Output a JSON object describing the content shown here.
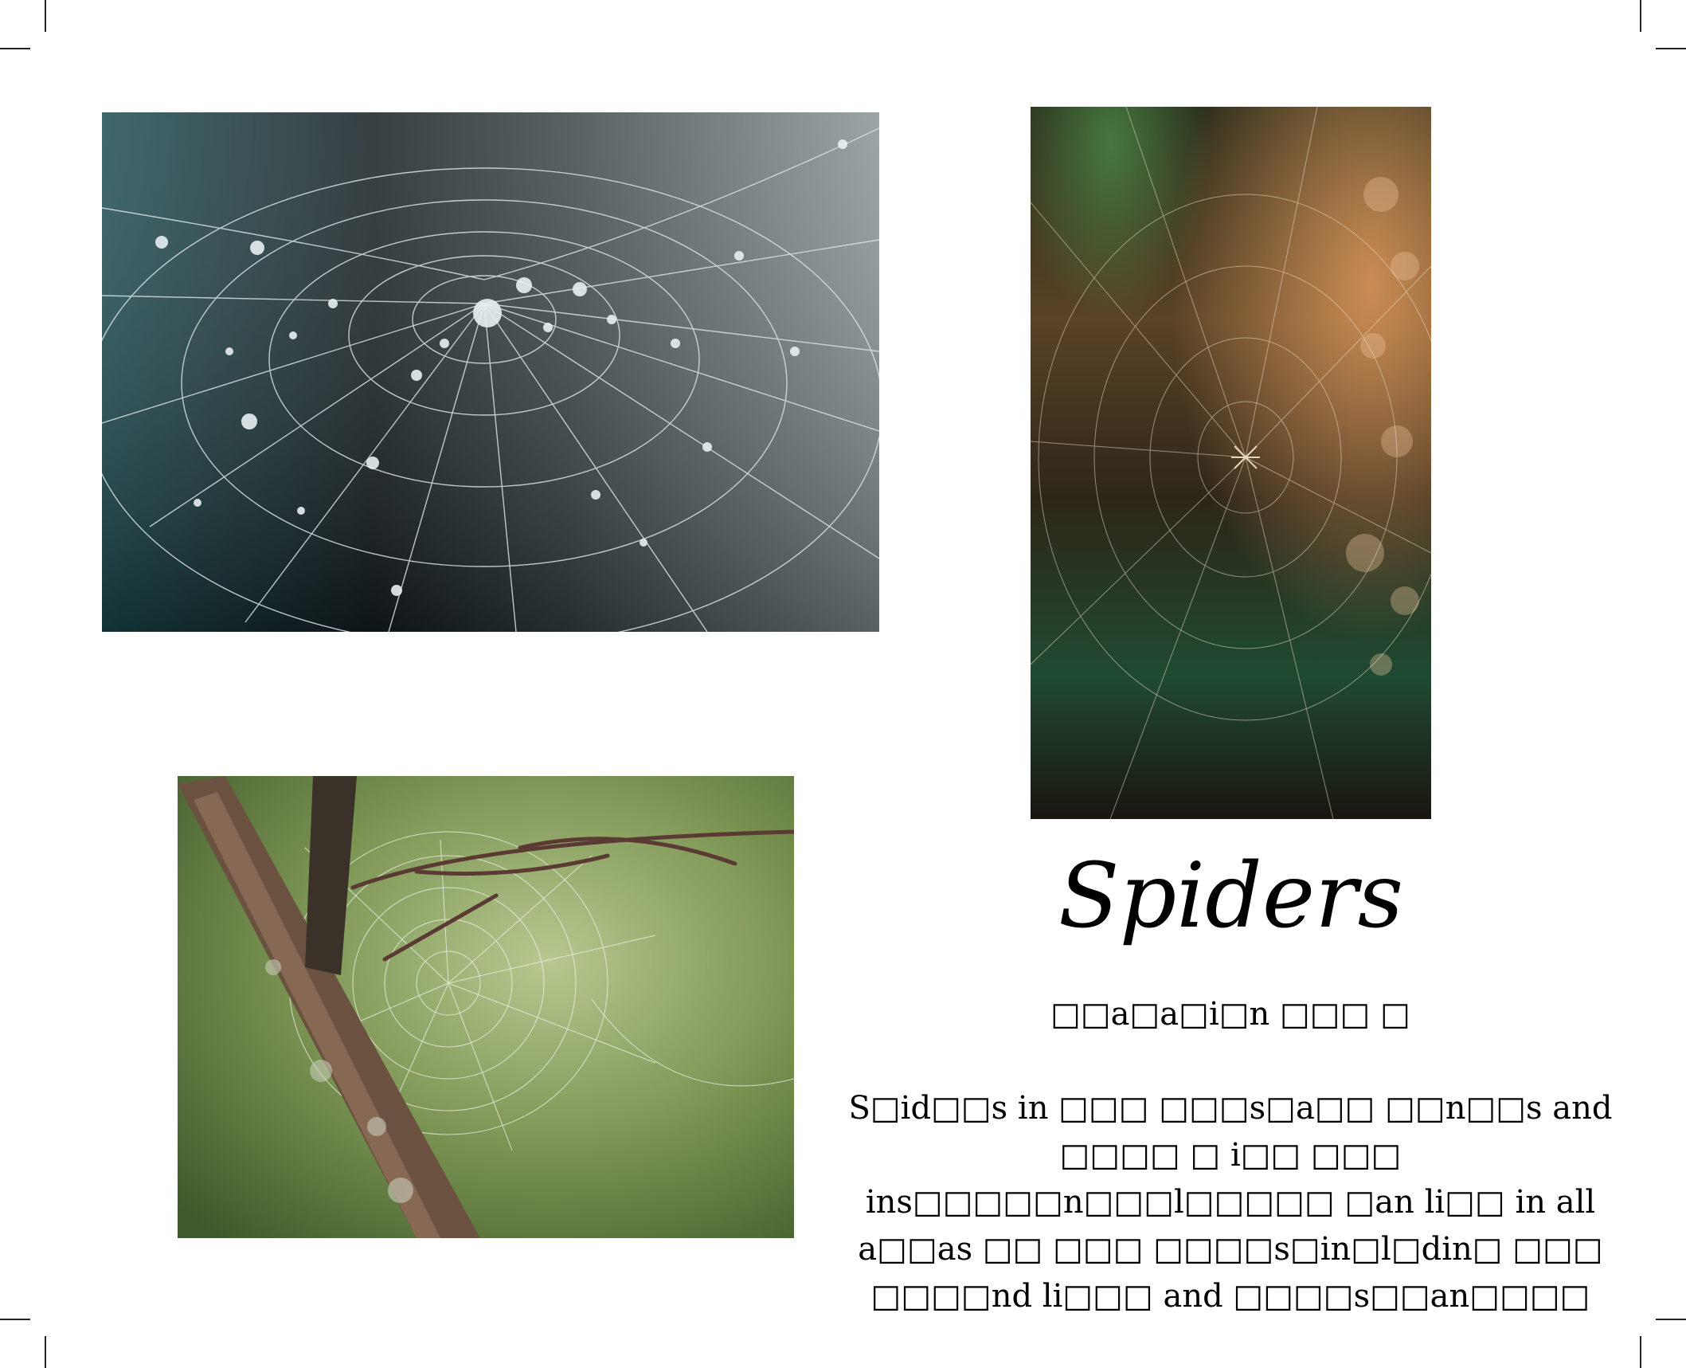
{
  "page": {
    "title": "Spiders",
    "subtitle": "□□a□a□i□n □□□ □",
    "body": "S□id□□s in □□□ □□□s□a□□ □□n□□s and □□□□ □ i□□ □□□ ins□□□□□n□□□l□□□□□ □an li□□ in all a□□as □□ □□□ □□□□s□in□l□din□ □□□ □□□□nd li□□□ and □□□□s□□an□□□□"
  },
  "images": [
    {
      "name": "dewy-spider-web-photo",
      "subject": "spider web with dew drops on dark teal background"
    },
    {
      "name": "forest-spider-web-photo",
      "subject": "spider web with small spider in sunlit forest"
    },
    {
      "name": "branch-spider-web-photo",
      "subject": "orb spider web on a tree branch with green background"
    }
  ],
  "colors": {
    "background": "#ffffff",
    "text": "#000000"
  }
}
